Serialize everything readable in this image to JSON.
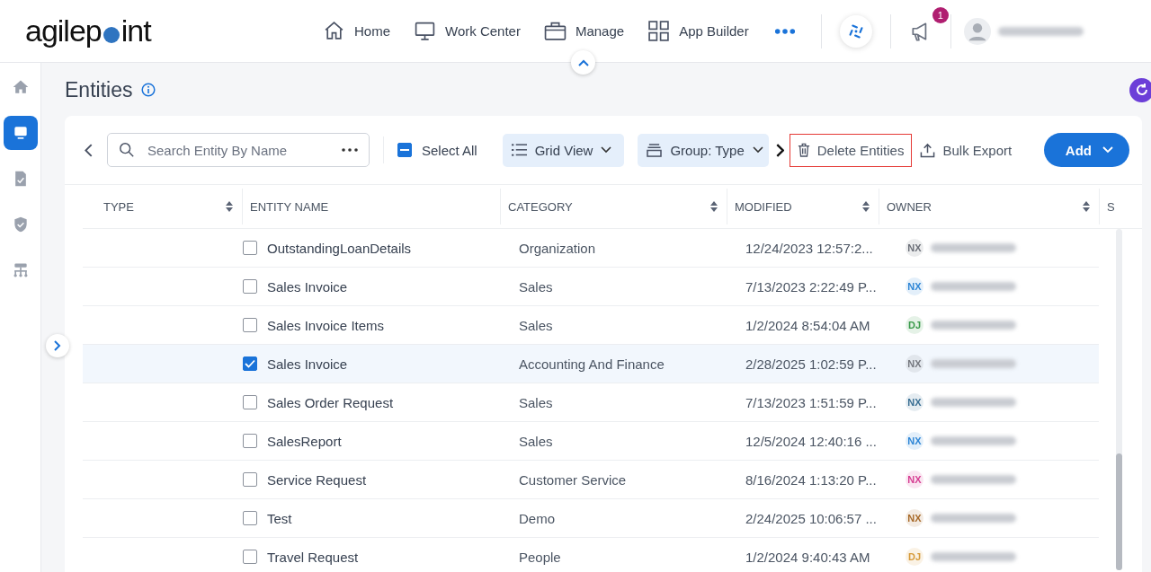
{
  "header": {
    "logo": {
      "before": "agilep",
      "after": "int"
    },
    "nav": [
      {
        "label": "Home"
      },
      {
        "label": "Work Center"
      },
      {
        "label": "Manage"
      },
      {
        "label": "App Builder"
      }
    ],
    "notification_count": "1"
  },
  "sidebar": {
    "items": [
      {
        "selected": false
      },
      {
        "selected": true
      },
      {
        "selected": false
      },
      {
        "selected": false
      },
      {
        "selected": false
      }
    ]
  },
  "page": {
    "title": "Entities"
  },
  "toolbar": {
    "search": {
      "placeholder": "Search Entity By Name"
    },
    "select_all": {
      "label": "Select All",
      "indeterminate": true
    },
    "items": [
      {
        "kind": "view",
        "label": "Grid View"
      },
      {
        "kind": "group",
        "label": "Group: Type"
      },
      {
        "kind": "delete",
        "label": "Delete Entities",
        "highlighted": true
      },
      {
        "kind": "export",
        "label": "Bulk Export",
        "highlighted": false
      },
      {
        "kind": "primary",
        "label": "Add"
      }
    ]
  },
  "table": {
    "columns": [
      {
        "label": "TYPE",
        "sortable": true
      },
      {
        "label": "ENTITY NAME",
        "sortable": false
      },
      {
        "label": "CATEGORY",
        "sortable": true
      },
      {
        "label": "MODIFIED",
        "sortable": true
      },
      {
        "label": "OWNER",
        "sortable": true
      },
      {
        "label": "S",
        "sortable": false
      }
    ],
    "rows": [
      {
        "name": "OutstandingLoanDetails",
        "category": "Organization",
        "modified": "12/24/2023 12:57:2...",
        "initials": "NX",
        "color": "#6b6f78",
        "selected": false
      },
      {
        "name": "Sales Invoice",
        "category": "Sales",
        "modified": "7/13/2023 2:22:49 P...",
        "initials": "NX",
        "color": "#2f86d6",
        "selected": false
      },
      {
        "name": "Sales Invoice Items",
        "category": "Sales",
        "modified": "1/2/2024 8:54:04 AM",
        "initials": "DJ",
        "color": "#3a9a4a",
        "selected": false
      },
      {
        "name": "Sales Invoice",
        "category": "Accounting And Finance",
        "modified": "2/28/2025 1:02:59 P...",
        "initials": "NX",
        "color": "#75787f",
        "selected": true
      },
      {
        "name": "Sales Order Request",
        "category": "Sales",
        "modified": "7/13/2023 1:51:59 P...",
        "initials": "NX",
        "color": "#3a6f93",
        "selected": false
      },
      {
        "name": "SalesReport",
        "category": "Sales",
        "modified": "12/5/2024 12:40:16 ...",
        "initials": "NX",
        "color": "#2f86d6",
        "selected": false
      },
      {
        "name": "Service Request",
        "category": "Customer Service",
        "modified": "8/16/2024 1:13:20 P...",
        "initials": "NX",
        "color": "#d63f93",
        "selected": false
      },
      {
        "name": "Test",
        "category": "Demo",
        "modified": "2/24/2025 10:06:57 ...",
        "initials": "NX",
        "color": "#a86a2a",
        "selected": false
      },
      {
        "name": "Travel Request",
        "category": "People",
        "modified": "1/2/2024 9:40:43 AM",
        "initials": "DJ",
        "color": "#d69a3a",
        "selected": false
      }
    ]
  }
}
